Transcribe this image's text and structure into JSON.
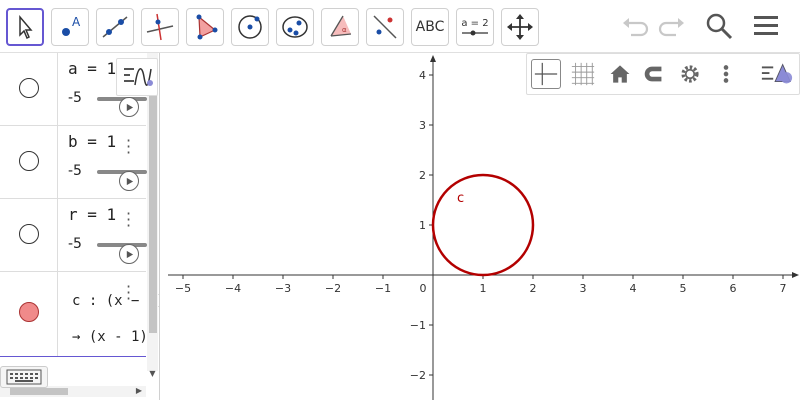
{
  "toolbar": {
    "tools": [
      {
        "name": "move-tool",
        "icon": "arrow-cursor-icon"
      },
      {
        "name": "point-tool",
        "icon": "point-icon"
      },
      {
        "name": "line-tool",
        "icon": "line-icon"
      },
      {
        "name": "perpendicular-line-tool",
        "icon": "perpendicular-icon"
      },
      {
        "name": "polygon-tool",
        "icon": "polygon-icon"
      },
      {
        "name": "circle-center-point-tool",
        "icon": "circle-center-icon"
      },
      {
        "name": "ellipse-tool",
        "icon": "ellipse-icon"
      },
      {
        "name": "angle-tool",
        "icon": "angle-icon"
      },
      {
        "name": "reflect-tool",
        "icon": "reflect-icon"
      },
      {
        "name": "text-tool",
        "label": "ABC"
      },
      {
        "name": "slider-tool",
        "label": "a = 2"
      },
      {
        "name": "move-graphics-view-tool",
        "icon": "move-arrows-icon"
      }
    ],
    "right": [
      "undo-icon",
      "redo-icon",
      "search-icon",
      "menu-icon"
    ]
  },
  "algebra": {
    "rows": [
      {
        "label": "a = 1",
        "min": "-5",
        "marble": "empty"
      },
      {
        "label": "b = 1",
        "min": "-5",
        "marble": "empty"
      },
      {
        "label": "r = 1",
        "min": "-5",
        "marble": "empty"
      },
      {
        "label": "c : (x − a)",
        "output": "→  (x - 1)",
        "marble": "filled"
      }
    ]
  },
  "graphics": {
    "x_ticks": [
      "−5",
      "−4",
      "−3",
      "−2",
      "−1",
      "0",
      "1",
      "2",
      "3",
      "4",
      "5",
      "6",
      "7"
    ],
    "y_ticks": [
      "4",
      "3",
      "2",
      "1",
      "−1",
      "−2"
    ],
    "circle_label": "c",
    "circle_color": "#b30000"
  },
  "colors": {
    "accent": "#6557d2",
    "circle": "#b30000",
    "marble_fill": "#f08a8a"
  }
}
